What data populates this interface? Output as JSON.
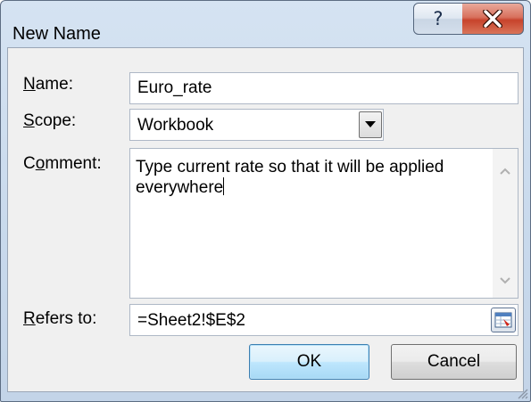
{
  "dialog": {
    "title": "New Name",
    "help_glyph": "?"
  },
  "form": {
    "name_label_accel": "N",
    "name_label_rest": "ame:",
    "name_value": "Euro_rate",
    "scope_label_accel": "S",
    "scope_label_rest": "cope:",
    "scope_value": "Workbook",
    "comment_label_pre": "C",
    "comment_label_accel": "o",
    "comment_label_rest": "mment:",
    "comment_value": "Type current rate so that it will be applied everywhere",
    "refers_label_accel": "R",
    "refers_label_rest": "efers to:",
    "refers_value": "=Sheet2!$E$2"
  },
  "buttons": {
    "ok": "OK",
    "cancel": "Cancel"
  },
  "icons": {
    "help": "question-mark-icon",
    "close": "close-icon",
    "dropdown": "chevron-down-icon",
    "scroll_up": "scroll-up-arrow-icon",
    "scroll_down": "scroll-down-arrow-icon",
    "range_selector": "collapse-dialog-icon",
    "resize": "resize-grip-icon"
  },
  "colors": {
    "close_button": "#c7432c",
    "ok_border": "#3c7fb1",
    "window_frame": "#c8d9ec",
    "panel": "#f0f0f0"
  }
}
